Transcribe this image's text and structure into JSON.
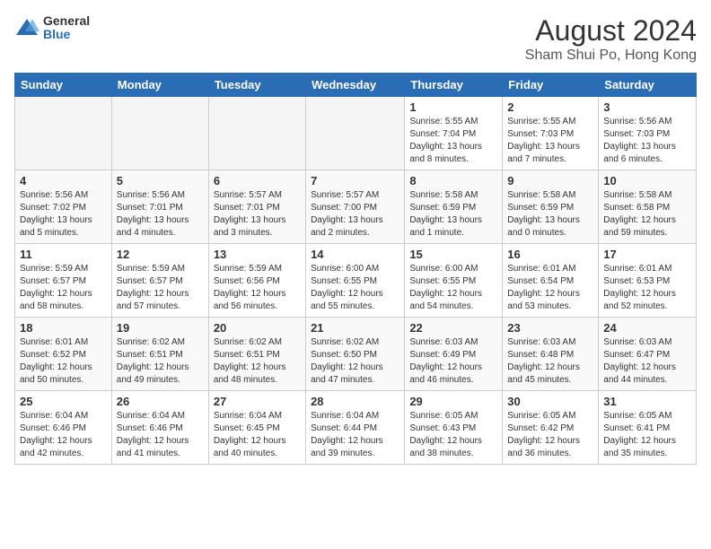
{
  "header": {
    "logo_general": "General",
    "logo_blue": "Blue",
    "title": "August 2024",
    "location": "Sham Shui Po, Hong Kong"
  },
  "days_of_week": [
    "Sunday",
    "Monday",
    "Tuesday",
    "Wednesday",
    "Thursday",
    "Friday",
    "Saturday"
  ],
  "weeks": [
    [
      {
        "day": "",
        "info": ""
      },
      {
        "day": "",
        "info": ""
      },
      {
        "day": "",
        "info": ""
      },
      {
        "day": "",
        "info": ""
      },
      {
        "day": "1",
        "info": "Sunrise: 5:55 AM\nSunset: 7:04 PM\nDaylight: 13 hours\nand 8 minutes."
      },
      {
        "day": "2",
        "info": "Sunrise: 5:55 AM\nSunset: 7:03 PM\nDaylight: 13 hours\nand 7 minutes."
      },
      {
        "day": "3",
        "info": "Sunrise: 5:56 AM\nSunset: 7:03 PM\nDaylight: 13 hours\nand 6 minutes."
      }
    ],
    [
      {
        "day": "4",
        "info": "Sunrise: 5:56 AM\nSunset: 7:02 PM\nDaylight: 13 hours\nand 5 minutes."
      },
      {
        "day": "5",
        "info": "Sunrise: 5:56 AM\nSunset: 7:01 PM\nDaylight: 13 hours\nand 4 minutes."
      },
      {
        "day": "6",
        "info": "Sunrise: 5:57 AM\nSunset: 7:01 PM\nDaylight: 13 hours\nand 3 minutes."
      },
      {
        "day": "7",
        "info": "Sunrise: 5:57 AM\nSunset: 7:00 PM\nDaylight: 13 hours\nand 2 minutes."
      },
      {
        "day": "8",
        "info": "Sunrise: 5:58 AM\nSunset: 6:59 PM\nDaylight: 13 hours\nand 1 minute."
      },
      {
        "day": "9",
        "info": "Sunrise: 5:58 AM\nSunset: 6:59 PM\nDaylight: 13 hours\nand 0 minutes."
      },
      {
        "day": "10",
        "info": "Sunrise: 5:58 AM\nSunset: 6:58 PM\nDaylight: 12 hours\nand 59 minutes."
      }
    ],
    [
      {
        "day": "11",
        "info": "Sunrise: 5:59 AM\nSunset: 6:57 PM\nDaylight: 12 hours\nand 58 minutes."
      },
      {
        "day": "12",
        "info": "Sunrise: 5:59 AM\nSunset: 6:57 PM\nDaylight: 12 hours\nand 57 minutes."
      },
      {
        "day": "13",
        "info": "Sunrise: 5:59 AM\nSunset: 6:56 PM\nDaylight: 12 hours\nand 56 minutes."
      },
      {
        "day": "14",
        "info": "Sunrise: 6:00 AM\nSunset: 6:55 PM\nDaylight: 12 hours\nand 55 minutes."
      },
      {
        "day": "15",
        "info": "Sunrise: 6:00 AM\nSunset: 6:55 PM\nDaylight: 12 hours\nand 54 minutes."
      },
      {
        "day": "16",
        "info": "Sunrise: 6:01 AM\nSunset: 6:54 PM\nDaylight: 12 hours\nand 53 minutes."
      },
      {
        "day": "17",
        "info": "Sunrise: 6:01 AM\nSunset: 6:53 PM\nDaylight: 12 hours\nand 52 minutes."
      }
    ],
    [
      {
        "day": "18",
        "info": "Sunrise: 6:01 AM\nSunset: 6:52 PM\nDaylight: 12 hours\nand 50 minutes."
      },
      {
        "day": "19",
        "info": "Sunrise: 6:02 AM\nSunset: 6:51 PM\nDaylight: 12 hours\nand 49 minutes."
      },
      {
        "day": "20",
        "info": "Sunrise: 6:02 AM\nSunset: 6:51 PM\nDaylight: 12 hours\nand 48 minutes."
      },
      {
        "day": "21",
        "info": "Sunrise: 6:02 AM\nSunset: 6:50 PM\nDaylight: 12 hours\nand 47 minutes."
      },
      {
        "day": "22",
        "info": "Sunrise: 6:03 AM\nSunset: 6:49 PM\nDaylight: 12 hours\nand 46 minutes."
      },
      {
        "day": "23",
        "info": "Sunrise: 6:03 AM\nSunset: 6:48 PM\nDaylight: 12 hours\nand 45 minutes."
      },
      {
        "day": "24",
        "info": "Sunrise: 6:03 AM\nSunset: 6:47 PM\nDaylight: 12 hours\nand 44 minutes."
      }
    ],
    [
      {
        "day": "25",
        "info": "Sunrise: 6:04 AM\nSunset: 6:46 PM\nDaylight: 12 hours\nand 42 minutes."
      },
      {
        "day": "26",
        "info": "Sunrise: 6:04 AM\nSunset: 6:46 PM\nDaylight: 12 hours\nand 41 minutes."
      },
      {
        "day": "27",
        "info": "Sunrise: 6:04 AM\nSunset: 6:45 PM\nDaylight: 12 hours\nand 40 minutes."
      },
      {
        "day": "28",
        "info": "Sunrise: 6:04 AM\nSunset: 6:44 PM\nDaylight: 12 hours\nand 39 minutes."
      },
      {
        "day": "29",
        "info": "Sunrise: 6:05 AM\nSunset: 6:43 PM\nDaylight: 12 hours\nand 38 minutes."
      },
      {
        "day": "30",
        "info": "Sunrise: 6:05 AM\nSunset: 6:42 PM\nDaylight: 12 hours\nand 36 minutes."
      },
      {
        "day": "31",
        "info": "Sunrise: 6:05 AM\nSunset: 6:41 PM\nDaylight: 12 hours\nand 35 minutes."
      }
    ]
  ]
}
